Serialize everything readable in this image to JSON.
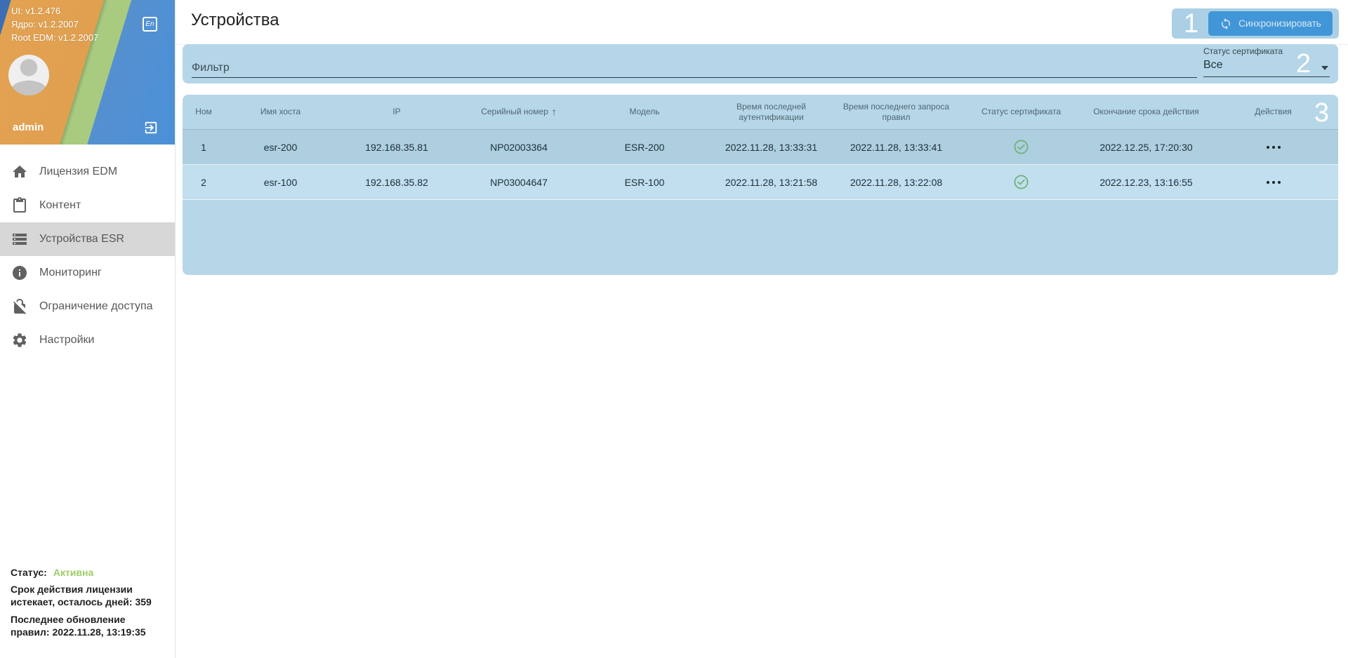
{
  "sidebar": {
    "versions": [
      "UI: v1.2.476",
      "Ядро: v1.2.2007",
      "Root EDM: v1.2.2007"
    ],
    "lang_button": "En",
    "username": "admin",
    "menu": [
      {
        "label": "Лицензия EDM",
        "icon": "home-icon",
        "active": false
      },
      {
        "label": "Контент",
        "icon": "clipboard-icon",
        "active": false
      },
      {
        "label": "Устройства ESR",
        "icon": "server-list-icon",
        "active": true
      },
      {
        "label": "Мониторинг",
        "icon": "info-icon",
        "active": false
      },
      {
        "label": "Ограничение доступа",
        "icon": "lock-off-icon",
        "active": false
      },
      {
        "label": "Настройки",
        "icon": "gear-icon",
        "active": false
      }
    ],
    "license": {
      "status_label": "Статус:",
      "status_value": "Активна",
      "line1": "Срок действия лицензии истекает, осталось дней: 359",
      "line2": "Последнее обновление правил: 2022.11.28, 13:19:35"
    }
  },
  "header": {
    "title": "Устройства",
    "sync_label": "Синхронизировать"
  },
  "filter": {
    "placeholder": "Фильтр",
    "cert_label": "Статус сертификата",
    "cert_value": "Все"
  },
  "annotations": {
    "one": "1",
    "two": "2",
    "three": "3"
  },
  "icons": {
    "sort_asc": "↑"
  },
  "table": {
    "columns": [
      "Ном",
      "Имя хоста",
      "IP",
      "Серийный номер",
      "Модель",
      "Время последней аутентификации",
      "Время последнего запроса правил",
      "Статус сертификата",
      "Окончание срока действия",
      "Действия"
    ],
    "sorted_column": "Серийный номер",
    "sort_direction": "asc",
    "rows": [
      {
        "num": "1",
        "hostname": "esr-200",
        "ip": "192.168.35.81",
        "serial": "NP02003364",
        "model": "ESR-200",
        "auth_time": "2022.11.28, 13:33:31",
        "rules_time": "2022.11.28, 13:33:41",
        "cert_status": "valid",
        "expiry": "2022.12.25, 17:20:30"
      },
      {
        "num": "2",
        "hostname": "esr-100",
        "ip": "192.168.35.82",
        "serial": "NP03004647",
        "model": "ESR-100",
        "auth_time": "2022.11.28, 13:21:58",
        "rules_time": "2022.11.28, 13:22:08",
        "cert_status": "valid",
        "expiry": "2022.12.23, 13:16:55"
      }
    ]
  },
  "colors": {
    "accent_blue": "#4196d8",
    "annotation_overlay": "#b4d6e8",
    "selected_row": "#adcfe0",
    "status_green": "#9ccc65",
    "cert_ok_green": "#6fb074"
  }
}
